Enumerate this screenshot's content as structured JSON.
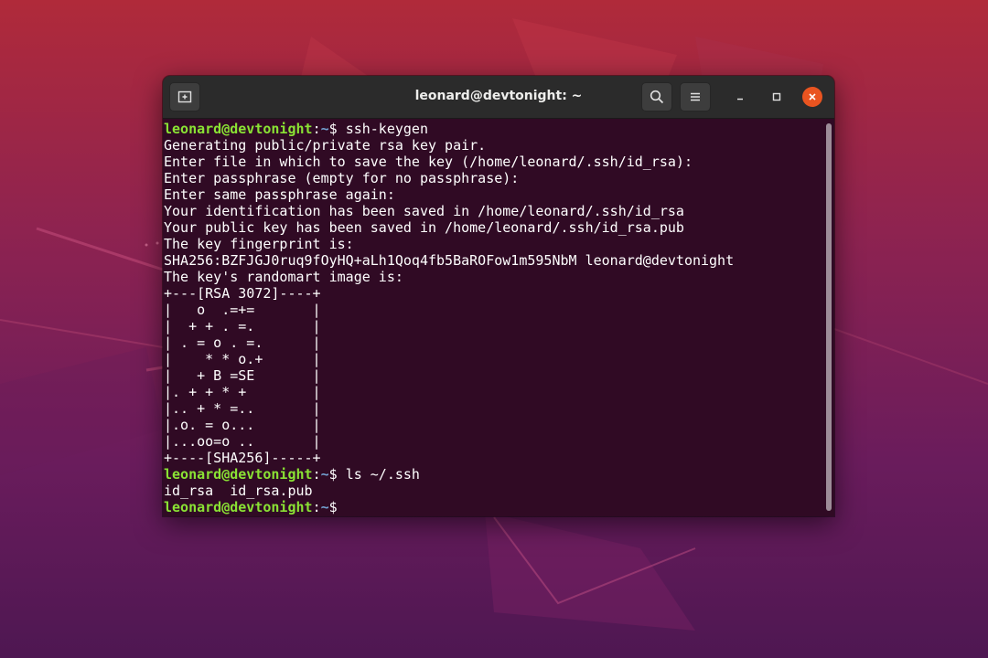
{
  "colors": {
    "terminal_bg": "#300a24",
    "prompt_user": "#8ae234",
    "prompt_path": "#729fcf",
    "text": "#ffffff",
    "close_button": "#e95420"
  },
  "window": {
    "title": "leonard@devtonight: ~",
    "icons": {
      "new_tab": "new-tab-icon",
      "search": "search-icon",
      "menu": "hamburger-menu-icon",
      "minimize": "minimize-icon",
      "maximize": "maximize-icon",
      "close": "close-icon"
    }
  },
  "terminal": {
    "prompt": {
      "user_host": "leonard@devtonight",
      "separator": ":",
      "path": "~",
      "symbol": "$ "
    },
    "commands": {
      "keygen": "ssh-keygen",
      "ls": "ls ~/.ssh"
    },
    "output": {
      "keygen_lines": [
        "Generating public/private rsa key pair.",
        "Enter file in which to save the key (/home/leonard/.ssh/id_rsa):",
        "Enter passphrase (empty for no passphrase):",
        "Enter same passphrase again:",
        "Your identification has been saved in /home/leonard/.ssh/id_rsa",
        "Your public key has been saved in /home/leonard/.ssh/id_rsa.pub",
        "The key fingerprint is:",
        "SHA256:BZFJGJ0ruq9fOyHQ+aLh1Qoq4fb5BaROFow1m595NbM leonard@devtonight",
        "The key's randomart image is:",
        "+---[RSA 3072]----+",
        "|   o  .=+=       |",
        "|  + + . =.       |",
        "| . = o . =.      |",
        "|    * * o.+      |",
        "|   + B =SE       |",
        "|. + + * +        |",
        "|.. + * =..       |",
        "|.o. = o...       |",
        "|...oo=o ..       |",
        "+----[SHA256]-----+"
      ],
      "ls_result": "id_rsa  id_rsa.pub"
    }
  }
}
